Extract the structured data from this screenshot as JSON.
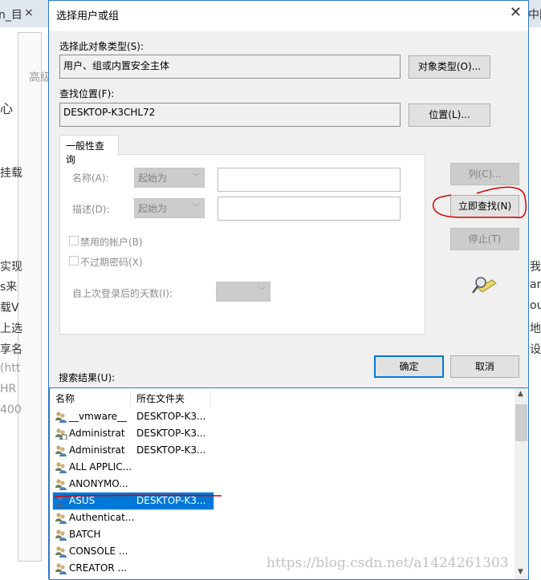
{
  "background": {
    "fragments": [
      "n_目",
      "×",
      "中国",
      "心",
      "挂载",
      "实现",
      "s来",
      "载V",
      "上选",
      "享名",
      "(htt",
      "HR",
      "400",
      "我",
      "ar",
      "ou",
      "地",
      "设置",
      "高级"
    ]
  },
  "dialog": {
    "title": "选择用户或组",
    "object_type_label": "选择此对象类型(S):",
    "object_type_value": "用户、组或内置安全主体",
    "object_type_button": "对象类型(O)...",
    "location_label": "查找位置(F):",
    "location_value": "DESKTOP-K3CHL72",
    "location_button": "位置(L)...",
    "tab": "一般性查询",
    "name_label": "名称(A):",
    "name_mode": "起始为",
    "desc_label": "描述(D):",
    "desc_mode": "起始为",
    "disabled_accounts": "禁用的帐户(B)",
    "non_expiring_pw": "不过期密码(X)",
    "days_label": "自上次登录后的天数(I):",
    "columns_button": "列(C)...",
    "find_now_button": "立即查找(N)",
    "stop_button": "停止(T)",
    "ok_button": "确定",
    "cancel_button": "取消",
    "results_label": "搜索结果(U):",
    "results": {
      "headers": [
        "名称",
        "所在文件夹"
      ],
      "rows": [
        {
          "name": "__vmware__",
          "folder": "DESKTOP-K3...",
          "icon": "group-icon"
        },
        {
          "name": "Administrat",
          "folder": "DESKTOP-K3...",
          "icon": "admin-user-icon"
        },
        {
          "name": "Administrat",
          "folder": "DESKTOP-K3...",
          "icon": "group-icon"
        },
        {
          "name": "ALL APPLIC...",
          "folder": "",
          "icon": "group-icon"
        },
        {
          "name": "ANONYMO...",
          "folder": "",
          "icon": "group-icon"
        },
        {
          "name": "ASUS",
          "folder": "DESKTOP-K3...",
          "icon": "user-icon",
          "selected": true
        },
        {
          "name": "Authenticat...",
          "folder": "",
          "icon": "group-icon"
        },
        {
          "name": "BATCH",
          "folder": "",
          "icon": "group-icon"
        },
        {
          "name": "CONSOLE ...",
          "folder": "",
          "icon": "group-icon"
        },
        {
          "name": "CREATOR ...",
          "folder": "",
          "icon": "group-icon"
        }
      ]
    }
  },
  "watermark": "https://blog.csdn.net/a1424261303",
  "colors": {
    "accent": "#0078d7",
    "annotation": "#e00000"
  }
}
